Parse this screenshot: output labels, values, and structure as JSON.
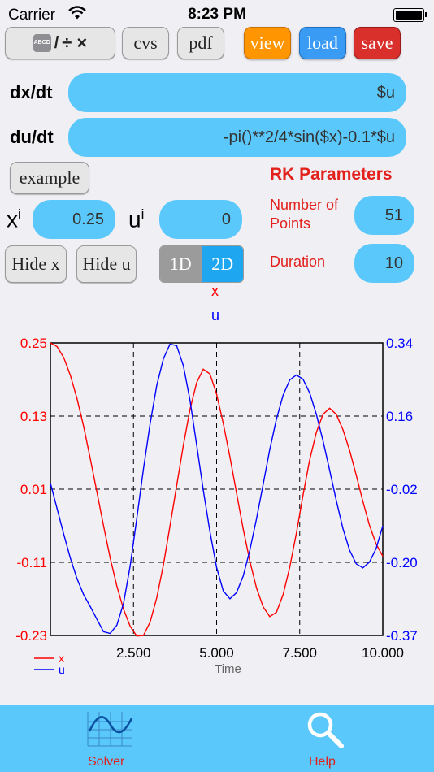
{
  "status_bar": {
    "carrier": "Carrier",
    "time": "8:23 PM"
  },
  "toolbar": {
    "keyboard_label": "÷ ×",
    "keyboard_small": "ABCD",
    "cvs_label": "cvs",
    "pdf_label": "pdf",
    "view_label": "view",
    "load_label": "load",
    "save_label": "save",
    "colors": {
      "view": "#ff9500",
      "load": "#3a9bf5",
      "save": "#d9302c"
    }
  },
  "equations": {
    "dx_label": "dx/dt",
    "dx_value": "$u",
    "du_label": "du/dt",
    "du_value": "-pi()**2/4*sin($x)-0.1*$u"
  },
  "example_label": "example",
  "initial": {
    "x_label": "x",
    "x_sup": "i",
    "x_value": "0.25",
    "u_label": "u",
    "u_sup": "i",
    "u_value": "0"
  },
  "rk": {
    "title": "RK Parameters",
    "points_label_1": "Number of",
    "points_label_2": "Points",
    "points_value": "51",
    "duration_label": "Duration",
    "duration_value": "10"
  },
  "hide_x_label": "Hide x",
  "hide_u_label": "Hide u",
  "mode": {
    "one_d": "1D",
    "two_d": "2D",
    "selected": "2D"
  },
  "plot_titles": {
    "x": "x",
    "u": "u"
  },
  "chart_data": {
    "type": "line",
    "xlabel": "Time",
    "xlim": [
      0,
      10
    ],
    "x_ticks": [
      "2.500",
      "5.000",
      "7.500",
      "10.000"
    ],
    "y_left_ticks": [
      "0.25",
      "0.13",
      "0.01",
      "-0.11",
      "-0.23"
    ],
    "y_left_lim": [
      -0.23,
      0.25
    ],
    "y_right_ticks": [
      "0.34",
      "0.16",
      "-0.02",
      "-0.20",
      "-0.37"
    ],
    "y_right_lim": [
      -0.37,
      0.34
    ],
    "grid": true,
    "legend_position": "bottom-left",
    "x": [
      0,
      0.2,
      0.4,
      0.6,
      0.8,
      1,
      1.2,
      1.4,
      1.6,
      1.8,
      2,
      2.2,
      2.4,
      2.6,
      2.8,
      3,
      3.2,
      3.4,
      3.6,
      3.8,
      4,
      4.2,
      4.4,
      4.6,
      4.8,
      5,
      5.2,
      5.4,
      5.6,
      5.8,
      6,
      6.2,
      6.4,
      6.6,
      6.8,
      7,
      7.2,
      7.4,
      7.6,
      7.8,
      8,
      8.2,
      8.4,
      8.6,
      8.8,
      9,
      9.2,
      9.4,
      9.6,
      9.8,
      10
    ],
    "series": [
      {
        "name": "x",
        "axis": "left",
        "color": "#ff0000",
        "values": [
          0.25,
          0.244,
          0.226,
          0.197,
          0.159,
          0.113,
          0.06,
          0.005,
          -0.05,
          -0.103,
          -0.149,
          -0.187,
          -0.215,
          -0.231,
          -0.23,
          -0.208,
          -0.168,
          -0.114,
          -0.05,
          0.016,
          0.082,
          0.141,
          0.185,
          0.207,
          0.199,
          0.166,
          0.118,
          0.063,
          0.004,
          -0.055,
          -0.108,
          -0.152,
          -0.183,
          -0.199,
          -0.192,
          -0.163,
          -0.118,
          -0.062,
          0.0,
          0.058,
          0.103,
          0.133,
          0.143,
          0.133,
          0.108,
          0.074,
          0.033,
          -0.01,
          -0.049,
          -0.08,
          -0.1
        ]
      },
      {
        "name": "u",
        "axis": "right",
        "color": "#0000ff",
        "values": [
          0,
          -0.062,
          -0.124,
          -0.182,
          -0.232,
          -0.271,
          -0.3,
          -0.331,
          -0.361,
          -0.365,
          -0.345,
          -0.292,
          -0.201,
          -0.086,
          0.034,
          0.144,
          0.237,
          0.302,
          0.337,
          0.333,
          0.285,
          0.201,
          0.092,
          -0.017,
          -0.118,
          -0.205,
          -0.262,
          -0.281,
          -0.266,
          -0.226,
          -0.163,
          -0.087,
          -0.003,
          0.081,
          0.155,
          0.213,
          0.25,
          0.262,
          0.252,
          0.219,
          0.167,
          0.103,
          0.031,
          -0.042,
          -0.11,
          -0.163,
          -0.196,
          -0.206,
          -0.192,
          -0.159,
          -0.104
        ]
      }
    ]
  },
  "tabs": [
    {
      "label": "Solver"
    },
    {
      "label": "Help"
    }
  ]
}
